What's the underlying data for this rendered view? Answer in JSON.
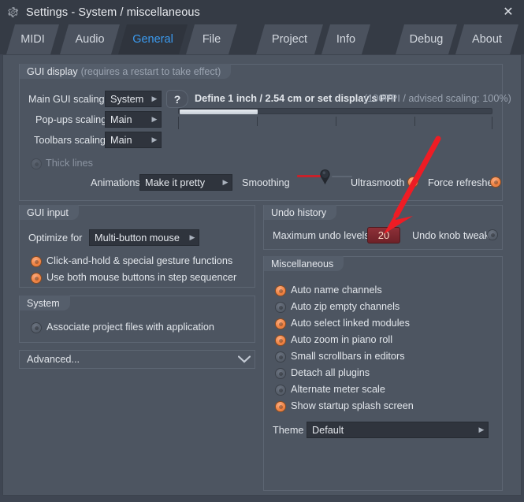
{
  "window": {
    "title": "Settings - System / miscellaneous",
    "gear_icon": "gear-icon",
    "close_icon": "close-icon",
    "close_label": "✕"
  },
  "tabs": [
    {
      "label": "MIDI",
      "active": false
    },
    {
      "label": "Audio",
      "active": false
    },
    {
      "label": "General",
      "active": true
    },
    {
      "label": "File",
      "active": false
    },
    {
      "label": "Project",
      "active": false
    },
    {
      "label": "Info",
      "active": false
    },
    {
      "label": "Debug",
      "active": false
    },
    {
      "label": "About",
      "active": false
    }
  ],
  "gui_display": {
    "title": "GUI display",
    "title_sub": "(requires a restart to take effect)",
    "main_gui_scaling_label": "Main GUI scaling",
    "main_gui_scaling_value": "System",
    "popups_scaling_label": "Pop-ups scaling",
    "popups_scaling_value": "Main",
    "toolbars_scaling_label": "Toolbars scaling",
    "toolbars_scaling_value": "Main",
    "help_label": "?",
    "ppi_hint": "Define 1 inch / 2.54 cm or set display's PPI",
    "ppi_hint_sub": "(100PPI / advised scaling: 100%)",
    "ppi_fill_percent": 25,
    "thick_lines_label": "Thick lines",
    "thick_lines_state": "off",
    "animations_label": "Animations",
    "animations_value": "Make it pretty",
    "smoothing_label": "Smoothing",
    "ultrasmooth_label": "Ultrasmooth",
    "ultrasmooth_state": "on",
    "force_refreshes_label": "Force refreshes",
    "force_refreshes_state": "on"
  },
  "gui_input": {
    "title": "GUI input",
    "optimize_label": "Optimize for",
    "optimize_value": "Multi-button mouse",
    "options": [
      {
        "label": "Click-and-hold & special gesture functions",
        "state": "on"
      },
      {
        "label": "Use both mouse buttons in step sequencer",
        "state": "on"
      }
    ]
  },
  "system": {
    "title": "System",
    "options": [
      {
        "label": "Associate project files with application",
        "state": "off"
      }
    ]
  },
  "advanced": {
    "label": "Advanced...",
    "chevron_icon": "chevron-down-icon"
  },
  "undo_history": {
    "title": "Undo history",
    "max_levels_label": "Maximum undo levels",
    "max_levels_value": "20",
    "undo_knob_label": "Undo knob tweaks",
    "undo_knob_state": "off"
  },
  "miscellaneous": {
    "title": "Miscellaneous",
    "options": [
      {
        "label": "Auto name channels",
        "state": "on"
      },
      {
        "label": "Auto zip empty channels",
        "state": "off"
      },
      {
        "label": "Auto select linked modules",
        "state": "on"
      },
      {
        "label": "Auto zoom in piano roll",
        "state": "on"
      },
      {
        "label": "Small scrollbars in editors",
        "state": "off"
      },
      {
        "label": "Detach all plugins",
        "state": "off"
      },
      {
        "label": "Alternate meter scale",
        "state": "off"
      },
      {
        "label": "Show startup splash screen",
        "state": "on"
      }
    ],
    "theme_label": "Theme",
    "theme_value": "Default"
  },
  "annotation": {
    "arrow_icon": "red-arrow-annotation",
    "color": "#ee1c24"
  },
  "colors": {
    "window_bg": "#3f4652",
    "panel_bg": "#4d5561",
    "titlebar_bg": "#353b45",
    "tab_bg": "#4b525e",
    "tab_active_bg": "#2f343d",
    "tab_active_text": "#3b9bf0",
    "accent_on": "#f07a35",
    "value_field_bg": "#7e2930",
    "slider_red": "#c7222b"
  }
}
